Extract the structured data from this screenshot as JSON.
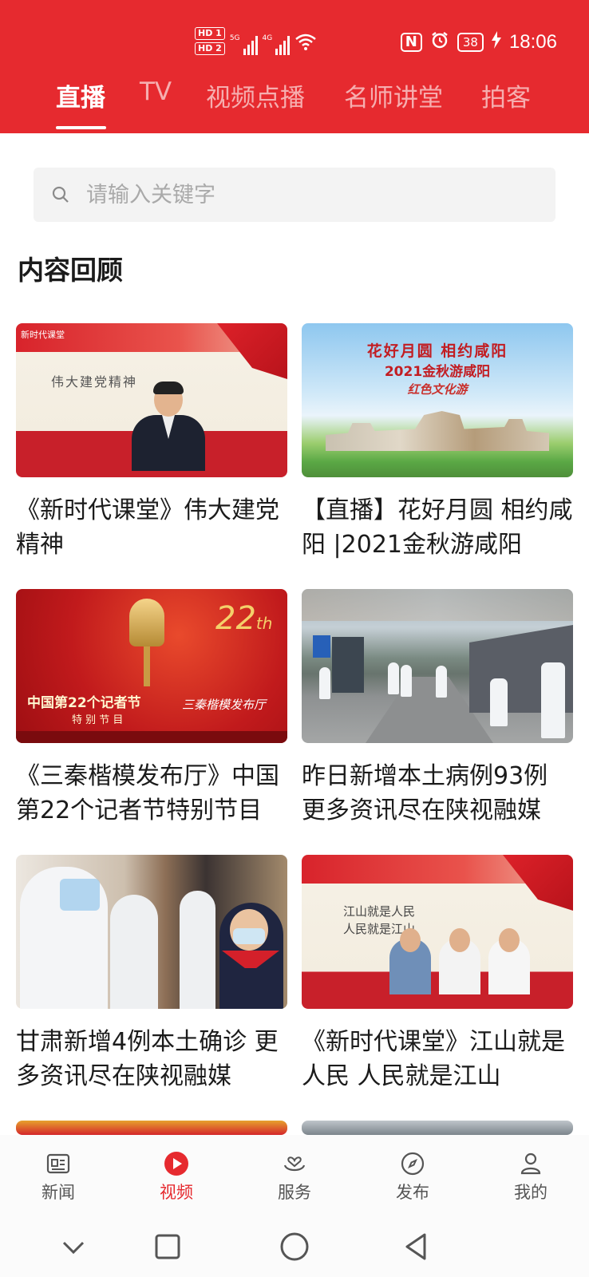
{
  "status_bar": {
    "hd1": "HD 1",
    "hd2": "HD 2",
    "sig1_label": "5G",
    "sig2_label": "4G",
    "nfc": "N",
    "battery": "38",
    "time": "18:06"
  },
  "tabs": [
    {
      "label": "直播",
      "active": true
    },
    {
      "label": "TV",
      "active": false
    },
    {
      "label": "视频点播",
      "active": false
    },
    {
      "label": "名师讲堂",
      "active": false
    },
    {
      "label": "拍客",
      "active": false
    }
  ],
  "search": {
    "placeholder": "请输入关键字"
  },
  "section": {
    "title": "内容回顾"
  },
  "cards": [
    {
      "title": "《新时代课堂》伟大建党精神",
      "thumb_text": "伟大建党精神",
      "thumb_logo": "新时代课堂"
    },
    {
      "title": "【直播】花好月圆 相约咸阳 |2021金秋游咸阳",
      "thumb_line1": "花好月圆  相约咸阳",
      "thumb_line2": "2021金秋游咸阳",
      "thumb_line3": "红色文化游"
    },
    {
      "title": "《三秦楷模发布厅》中国第22个记者节特别节目",
      "thumb_num": "22",
      "thumb_th": "th",
      "thumb_line1": "中国第22个记者节",
      "thumb_line2": "特 别 节 目",
      "thumb_line3": "三秦楷模发布厅"
    },
    {
      "title": "昨日新增本土病例93例 更多资讯尽在陕视融媒"
    },
    {
      "title": "甘肃新增4例本土确诊 更多资讯尽在陕视融媒"
    },
    {
      "title": "《新时代课堂》江山就是人民 人民就是江山",
      "thumb_line1": "江山就是人民",
      "thumb_line2": "人民就是江山"
    }
  ],
  "bottom_nav": [
    {
      "label": "新闻",
      "icon": "news-icon",
      "active": false
    },
    {
      "label": "视频",
      "icon": "video-play-icon",
      "active": true
    },
    {
      "label": "服务",
      "icon": "service-icon",
      "active": false
    },
    {
      "label": "发布",
      "icon": "compass-icon",
      "active": false
    },
    {
      "label": "我的",
      "icon": "user-icon",
      "active": false
    }
  ],
  "colors": {
    "brand_red": "#e62a2f",
    "text": "#1b1b1b",
    "muted": "#555555"
  }
}
